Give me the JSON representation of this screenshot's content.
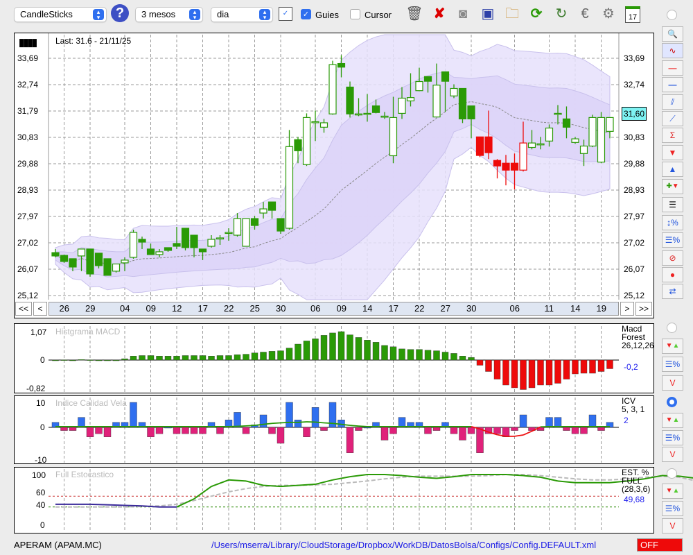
{
  "toolbar": {
    "chart_type": "CandleSticks",
    "period": "3 mesos",
    "interval": "dia",
    "guides_label": "Guies",
    "guides_checked": true,
    "cursor_label": "Cursor",
    "cursor_checked": false,
    "icons": [
      "help-icon",
      "window-icon",
      "trash-icon",
      "delete-icon",
      "lamp-icon",
      "save-icon",
      "open-folder-icon",
      "refresh-icon",
      "sync-icon",
      "euro-icon",
      "gear-icon",
      "calendar-icon"
    ],
    "calendar_day": "17"
  },
  "main": {
    "last": "Last: 31.6 - 21/11/25",
    "current_price": "31,60",
    "y_ticks": [
      "33,69",
      "32,74",
      "31,79",
      "30,83",
      "29,88",
      "28,93",
      "27,97",
      "27,02",
      "26,07",
      "25,12"
    ],
    "nav": {
      "first": "<<",
      "prev": "<",
      "next": ">",
      "last": ">>"
    },
    "dates": [
      {
        "i": 1,
        "t": "26"
      },
      {
        "i": 4,
        "t": "29"
      },
      {
        "i": 8,
        "t": "04"
      },
      {
        "i": 11,
        "t": "09"
      },
      {
        "i": 14,
        "t": "12"
      },
      {
        "i": 17,
        "t": "17"
      },
      {
        "i": 20,
        "t": "22"
      },
      {
        "i": 23,
        "t": "25"
      },
      {
        "i": 26,
        "t": "30"
      },
      {
        "i": 30,
        "t": "06"
      },
      {
        "i": 33,
        "t": "09"
      },
      {
        "i": 36,
        "t": "14"
      },
      {
        "i": 39,
        "t": "17"
      },
      {
        "i": 42,
        "t": "22"
      },
      {
        "i": 45,
        "t": "27"
      },
      {
        "i": 48,
        "t": "30"
      },
      {
        "i": 53,
        "t": "06"
      },
      {
        "i": 57,
        "t": "11"
      },
      {
        "i": 60,
        "t": "14"
      },
      {
        "i": 63,
        "t": "19"
      }
    ]
  },
  "macd": {
    "title": "Histgrama MACD",
    "name": "Macd",
    "name2": "Forest",
    "params": "26,12,26",
    "value": "-0,2",
    "y_ticks": [
      "1,07",
      "0",
      "-0,82"
    ]
  },
  "icv": {
    "title": "Indice Calidad Vela",
    "name": "ICV",
    "params": "5, 3, 1",
    "value": "2",
    "y_ticks": [
      "10",
      "0",
      "-10"
    ]
  },
  "stoch": {
    "title": "Full Estocastico",
    "name": "EST. %",
    "name2": "FULL",
    "params": "(28,3,6)",
    "value": "49,68",
    "y_ticks": [
      "100",
      "60",
      "40",
      "0"
    ]
  },
  "status": {
    "ticker": "APERAM (APAM.MC)",
    "path": "/Users/mserra/Library/CloudStorage/Dropbox/WorkDB/DatosBolsa/Configs/Config.DEFAULT.xml",
    "off": "OFF"
  },
  "colors": {
    "up": "#2a9a06",
    "down": "#ee0a0a",
    "band": "#e6e0fb",
    "band_inner": "#ddd4f8",
    "icv_pos": "#2f6fef",
    "icv_neg": "#e0217a",
    "accent": "#2f6fef"
  },
  "chart_data": [
    {
      "type": "candlestick",
      "ylim": [
        25.12,
        33.69
      ],
      "candles": [
        [
          26.67,
          26.8,
          26.5,
          26.55,
          "g"
        ],
        [
          26.57,
          26.6,
          26.3,
          26.35,
          "g"
        ],
        [
          26.45,
          26.45,
          26.0,
          26.15,
          "g"
        ],
        [
          26.55,
          26.8,
          26.0,
          26.8,
          "g"
        ],
        [
          26.8,
          26.8,
          25.8,
          25.9,
          "g"
        ],
        [
          26.65,
          26.65,
          26.1,
          26.2,
          "g"
        ],
        [
          26.45,
          26.45,
          25.85,
          25.85,
          "g"
        ],
        [
          26.0,
          26.26,
          25.95,
          26.26,
          "g"
        ],
        [
          26.3,
          26.5,
          26.0,
          26.4,
          "g"
        ],
        [
          26.5,
          27.5,
          26.45,
          27.4,
          "g"
        ],
        [
          27.15,
          27.25,
          26.8,
          27.05,
          "g"
        ],
        [
          26.8,
          27.0,
          26.6,
          26.6,
          "g"
        ],
        [
          26.6,
          26.8,
          26.5,
          26.7,
          "g"
        ],
        [
          26.85,
          26.85,
          26.7,
          26.75,
          "g"
        ],
        [
          27.0,
          27.6,
          26.8,
          26.9,
          "g"
        ],
        [
          27.55,
          27.55,
          26.75,
          26.85,
          "g"
        ],
        [
          27.3,
          27.3,
          26.5,
          26.85,
          "g"
        ],
        [
          26.8,
          26.8,
          26.4,
          26.7,
          "g"
        ],
        [
          26.9,
          27.3,
          26.85,
          27.15,
          "g"
        ],
        [
          27.2,
          27.3,
          26.95,
          27.2,
          "g"
        ],
        [
          27.4,
          27.55,
          27.1,
          27.4,
          "g"
        ],
        [
          27.3,
          28.1,
          27.25,
          27.9,
          "g"
        ],
        [
          26.9,
          27.9,
          26.9,
          27.9,
          "g"
        ],
        [
          27.9,
          28.0,
          27.5,
          27.65,
          "g"
        ],
        [
          28.1,
          28.5,
          27.9,
          28.25,
          "g"
        ],
        [
          28.5,
          28.5,
          27.9,
          28.2,
          "g"
        ],
        [
          27.9,
          27.9,
          27.35,
          27.45,
          "g"
        ],
        [
          27.55,
          31.1,
          27.5,
          30.5,
          "g"
        ],
        [
          30.75,
          30.85,
          29.9,
          30.35,
          "g"
        ],
        [
          29.85,
          31.7,
          29.8,
          31.55,
          "g"
        ],
        [
          31.4,
          31.8,
          30.7,
          31.4,
          "g"
        ],
        [
          31.2,
          31.5,
          31.0,
          31.36,
          "g"
        ],
        [
          31.68,
          33.6,
          31.65,
          33.46,
          "g"
        ],
        [
          33.5,
          33.8,
          33.0,
          33.37,
          "g"
        ],
        [
          32.65,
          32.85,
          31.55,
          31.68,
          "g"
        ],
        [
          31.68,
          32.25,
          31.6,
          31.68,
          "g"
        ],
        [
          31.7,
          32.4,
          31.4,
          31.7,
          "g"
        ],
        [
          31.97,
          32.2,
          31.7,
          31.73,
          "g"
        ],
        [
          31.6,
          31.75,
          31.5,
          31.6,
          "g"
        ],
        [
          30.17,
          32.3,
          29.9,
          31.55,
          "g"
        ],
        [
          31.7,
          32.65,
          31.5,
          32.25,
          "g"
        ],
        [
          32.15,
          33.15,
          31.95,
          32.27,
          "g"
        ],
        [
          32.52,
          33.35,
          32.5,
          32.85,
          "g"
        ],
        [
          33.03,
          33.03,
          32.45,
          32.86,
          "g"
        ],
        [
          31.57,
          33.5,
          31.55,
          32.72,
          "g"
        ],
        [
          33.2,
          33.2,
          31.75,
          32.86,
          "g"
        ],
        [
          32.33,
          32.75,
          32.25,
          32.6,
          "g"
        ],
        [
          32.6,
          32.6,
          31.35,
          31.5,
          "g"
        ],
        [
          31.97,
          31.97,
          30.8,
          31.5,
          "g"
        ],
        [
          30.85,
          30.85,
          30.12,
          30.18,
          "r"
        ],
        [
          30.85,
          31.8,
          30.05,
          30.28,
          "r"
        ],
        [
          30.0,
          30.05,
          29.35,
          29.8,
          "r"
        ],
        [
          29.9,
          30.2,
          29.1,
          29.65,
          "r"
        ],
        [
          29.9,
          30.25,
          28.95,
          29.65,
          "r"
        ],
        [
          29.65,
          31.4,
          29.6,
          30.63,
          "r"
        ],
        [
          30.47,
          31.1,
          30.4,
          30.63,
          "g"
        ],
        [
          30.6,
          30.85,
          30.4,
          30.6,
          "g"
        ],
        [
          30.7,
          31.3,
          30.5,
          31.17,
          "g"
        ],
        [
          31.7,
          32.0,
          31.3,
          31.7,
          "g"
        ],
        [
          31.5,
          31.95,
          30.8,
          31.2,
          "g"
        ],
        [
          30.65,
          30.85,
          30.6,
          30.78,
          "g"
        ],
        [
          30.25,
          30.75,
          29.8,
          30.52,
          "g"
        ],
        [
          30.52,
          31.65,
          30.48,
          31.55,
          "g"
        ],
        [
          29.94,
          31.75,
          29.9,
          31.55,
          "g"
        ],
        [
          31.05,
          31.55,
          30.8,
          31.55,
          "g"
        ]
      ]
    },
    {
      "type": "bar",
      "name": "MACD histogram",
      "ylim": [
        -0.82,
        1.07
      ],
      "values": [
        0,
        0.01,
        0,
        0.02,
        0.01,
        0,
        0,
        0,
        0.05,
        0.15,
        0.17,
        0.17,
        0.15,
        0.15,
        0.15,
        0.17,
        0.17,
        0.17,
        0.15,
        0.17,
        0.17,
        0.2,
        0.22,
        0.27,
        0.3,
        0.33,
        0.35,
        0.45,
        0.6,
        0.72,
        0.8,
        0.93,
        1.02,
        1.07,
        0.95,
        0.85,
        0.75,
        0.67,
        0.55,
        0.5,
        0.42,
        0.4,
        0.4,
        0.37,
        0.35,
        0.3,
        0.25,
        0.15,
        0.1,
        -0.15,
        -0.33,
        -0.55,
        -0.72,
        -0.8,
        -0.85,
        -0.8,
        -0.72,
        -0.72,
        -0.67,
        -0.55,
        -0.4,
        -0.38,
        -0.38,
        -0.33,
        -0.25
      ]
    },
    {
      "type": "bar",
      "name": "ICV",
      "ylim": [
        -10,
        10
      ],
      "values": [
        2,
        -1,
        -1,
        4,
        -3,
        -2,
        -3,
        2,
        2,
        10,
        2,
        -3,
        -2,
        0,
        -2,
        -2,
        -2,
        -2,
        2,
        -2,
        3,
        6,
        -2,
        1,
        5,
        -2,
        -5,
        10,
        3,
        -3,
        8,
        -1,
        10,
        3,
        -8,
        -1,
        0,
        2,
        -4,
        -2,
        4,
        2,
        2,
        -2,
        -1,
        2,
        -2,
        -4,
        -2,
        -8,
        -2,
        -2,
        -3,
        -1,
        5,
        -1,
        -1,
        4,
        4,
        -1,
        -2,
        -2,
        5,
        -1,
        2
      ],
      "line": [
        0.3,
        0.3,
        0.3,
        0.3,
        0.3,
        0.3,
        0.3,
        0.3,
        0.3,
        0.3,
        0.3,
        0.3,
        0.3,
        0.3,
        0.3,
        0.3,
        0.3,
        0.3,
        0.3,
        0.3,
        0.3,
        0.4,
        0.6,
        0.8,
        1.2,
        1.6,
        1.8,
        2.0,
        2.0,
        2.2,
        2.1,
        1.8,
        1.6,
        1.2,
        0.8,
        0.5,
        0.3,
        0.3,
        0.3,
        0.3,
        0.3,
        0.3,
        0.3,
        0.3,
        0.3,
        0.3,
        0.3,
        0.3,
        0.3,
        -0.5,
        -1.5,
        -2.3,
        -2.8,
        -2.8,
        -2.4,
        -1.2,
        0.2,
        0.3,
        0.3,
        0.3,
        0.3,
        0.3,
        0.3,
        0.3,
        0.3
      ],
      "red_range": [
        48,
        56
      ]
    },
    {
      "type": "line",
      "name": "Full Stochastic",
      "ylim": [
        0,
        100
      ],
      "step": 2,
      "k": [
        45,
        45,
        45,
        44,
        43,
        42,
        40,
        40,
        55,
        78,
        90,
        88,
        80,
        78,
        80,
        82,
        90,
        96,
        100,
        100,
        98,
        95,
        93,
        96,
        100,
        100,
        100,
        98,
        95,
        88,
        85,
        85,
        85,
        88,
        92,
        98,
        97,
        93,
        88,
        75,
        60,
        48,
        40,
        38,
        42,
        44,
        45,
        45,
        45,
        44,
        42,
        48,
        50
      ],
      "d": [
        40,
        40,
        40,
        40,
        40,
        41,
        42,
        45,
        52,
        60,
        68,
        74,
        78,
        80,
        80,
        81,
        82,
        85,
        88,
        92,
        95,
        97,
        97,
        97,
        97,
        98,
        100,
        100,
        98,
        95,
        92,
        90,
        90,
        92,
        95,
        97,
        95,
        88,
        78,
        68,
        58,
        50,
        45,
        42,
        42,
        43,
        44,
        45,
        45,
        45,
        44,
        45,
        46
      ],
      "red_range": [
        38,
        45
      ]
    }
  ]
}
